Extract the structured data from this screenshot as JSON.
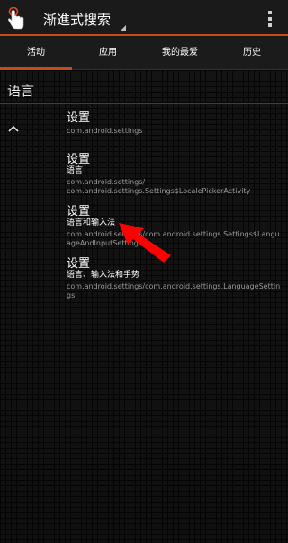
{
  "actionbar": {
    "title": "渐進式搜索",
    "app_icon": "finger-tap-icon",
    "overflow_icon": "more-vert-icon"
  },
  "tabs": [
    {
      "label": "活动",
      "active": true
    },
    {
      "label": "应用",
      "active": false
    },
    {
      "label": "我的最爱",
      "active": false
    },
    {
      "label": "历史",
      "active": false
    }
  ],
  "section": {
    "title": "语言",
    "collapse_icon": "chevron-up-icon"
  },
  "items": [
    {
      "title": "设置",
      "subtitle": "",
      "package": "com.android.settings"
    },
    {
      "title": "设置",
      "subtitle": "语言",
      "package": "com.android.settings/\ncom.android.settings.Settings$LocalePickerActivity"
    },
    {
      "title": "设置",
      "subtitle": "语言和输入法",
      "package": "com.android.settings/com.android.settings.Settings$LanguageAndInputSettings"
    },
    {
      "title": "设置",
      "subtitle": "语言、输入法和手势",
      "package": "com.android.settings/com.android.settings.LanguageSettings"
    }
  ],
  "colors": {
    "accent": "#c84a1c",
    "annotation_arrow": "#ff0000"
  }
}
